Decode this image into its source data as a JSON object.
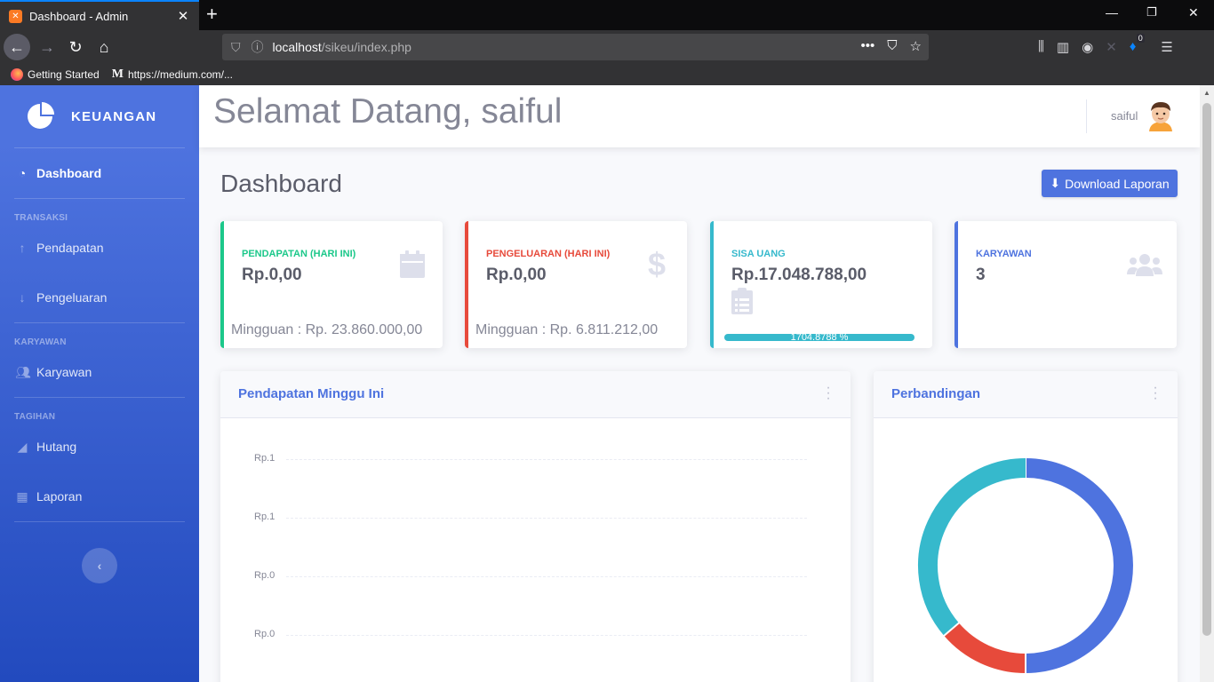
{
  "browser": {
    "tab_title": "Dashboard - Admin",
    "tab_close": "✕",
    "new_tab": "+",
    "url_host": "localhost",
    "url_path": "/sikeu/index.php",
    "bookmarks": [
      {
        "label": "Getting Started"
      },
      {
        "label": "https://medium.com/..."
      }
    ],
    "notification_badge": "0"
  },
  "sidebar": {
    "brand": "KEUANGAN",
    "items": [
      {
        "label": "Dashboard",
        "icon": "tachometer-icon",
        "active": true
      },
      {
        "heading": "TRANSAKSI"
      },
      {
        "label": "Pendapatan",
        "icon": "arrow-up-icon"
      },
      {
        "label": "Pengeluaran",
        "icon": "arrow-down-icon"
      },
      {
        "heading": "KARYAWAN"
      },
      {
        "label": "Karyawan",
        "icon": "users-icon"
      },
      {
        "heading": "TAGIHAN"
      },
      {
        "label": "Hutang",
        "icon": "chart-area-icon"
      },
      {
        "label": "Laporan",
        "icon": "table-icon"
      }
    ],
    "heading_transaksi": "TRANSAKSI",
    "heading_karyawan": "KARYAWAN",
    "heading_tagihan": "TAGIHAN",
    "toggle_label": "‹"
  },
  "topbar": {
    "greeting": "Selamat Datang, saiful",
    "username": "saiful"
  },
  "main": {
    "title": "Dashboard",
    "download_button": "Download Laporan",
    "cards": [
      {
        "label": "PENDAPATAN (HARI INI)",
        "value": "Rp.0,00",
        "weekly": "Mingguan : Rp. 23.860.000,00",
        "color": "#1cc88a",
        "icon": "calendar-icon"
      },
      {
        "label": "PENGELUARAN (HARI INI)",
        "value": "Rp.0,00",
        "weekly": "Mingguan : Rp. 6.811.212,00",
        "color": "#e74a3b",
        "icon": "dollar-icon"
      },
      {
        "label": "SISA UANG",
        "value": "Rp.17.048.788,00",
        "progress_text": "1704.8788 %",
        "progress_fill": 1.0,
        "color": "#36b9cc",
        "icon": "clipboard-list-icon"
      },
      {
        "label": "KARYAWAN",
        "value": "3",
        "color": "#4e73df",
        "icon": "users-icon"
      }
    ],
    "income_panel": {
      "title": "Pendapatan Minggu Ini",
      "y_labels": [
        "Rp.1",
        "Rp.1",
        "Rp.0",
        "Rp.0"
      ]
    },
    "comparison_panel": {
      "title": "Perbandingan"
    }
  },
  "chart_data": [
    {
      "type": "line",
      "title": "Pendapatan Minggu Ini",
      "y_tick_labels": [
        "Rp.1",
        "Rp.1",
        "Rp.0",
        "Rp.0"
      ],
      "series": []
    },
    {
      "type": "pie",
      "title": "Perbandingan",
      "donut": true,
      "slices": [
        {
          "value": 50.0,
          "color": "#4e73df"
        },
        {
          "value": 13.7,
          "color": "#e74a3b"
        },
        {
          "value": 36.3,
          "color": "#36b9cc"
        }
      ]
    }
  ]
}
